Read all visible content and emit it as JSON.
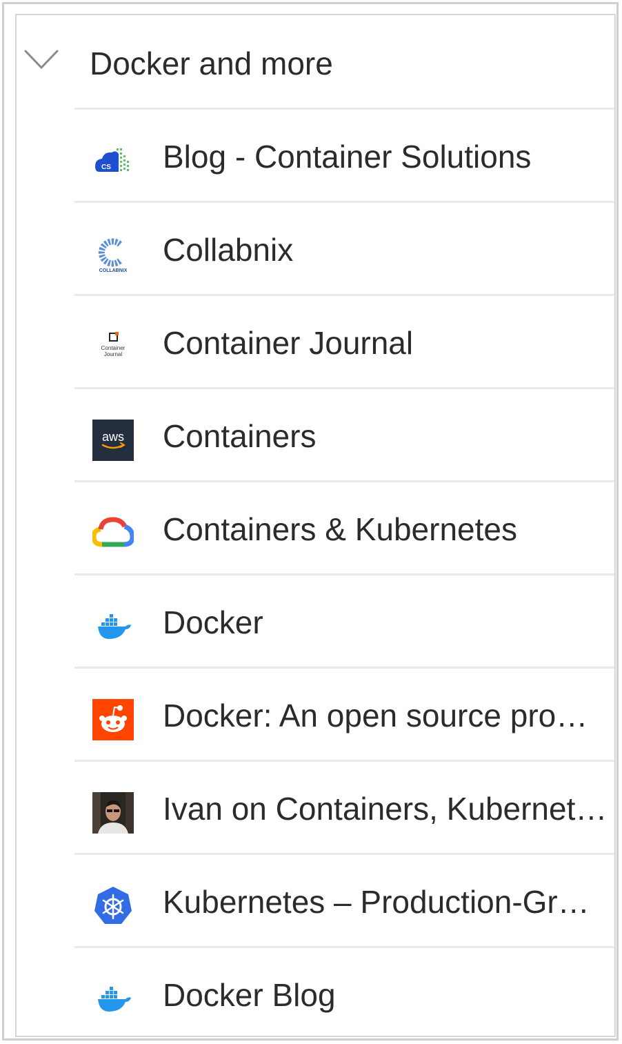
{
  "folder": {
    "title": "Docker and more",
    "expanded": true
  },
  "items": [
    {
      "label": "Blog - Container Solutions",
      "icon": "container-solutions-icon",
      "icon_text": "CS"
    },
    {
      "label": "Collabnix",
      "icon": "collabnix-icon",
      "icon_text": "COLLABNIX"
    },
    {
      "label": "Container Journal",
      "icon": "container-journal-icon",
      "icon_text": "Container Journal"
    },
    {
      "label": "Containers",
      "icon": "aws-icon",
      "icon_text": "aws"
    },
    {
      "label": "Containers & Kubernetes",
      "icon": "google-cloud-icon"
    },
    {
      "label": "Docker",
      "icon": "docker-icon"
    },
    {
      "label": "Docker: An open source pro…",
      "icon": "reddit-icon"
    },
    {
      "label": "Ivan on Containers, Kubernet…",
      "icon": "avatar-photo-icon"
    },
    {
      "label": "Kubernetes – Production-Gr…",
      "icon": "kubernetes-icon"
    },
    {
      "label": "Docker Blog",
      "icon": "docker-icon"
    }
  ],
  "colors": {
    "text": "#2b2b2b",
    "separator": "#e9e9e9",
    "aws_bg": "#232f3e",
    "reddit_bg": "#ff4500",
    "docker_blue": "#2496ed",
    "kubernetes_blue": "#326ce5"
  }
}
